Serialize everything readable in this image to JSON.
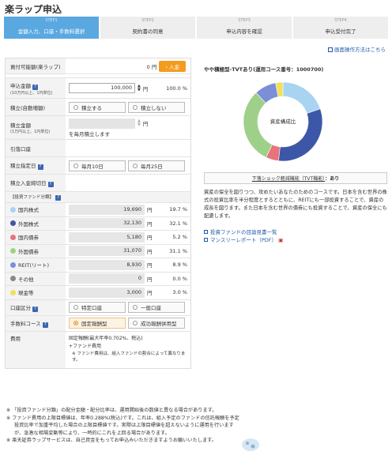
{
  "page_title": "楽ラップ申込",
  "steps": [
    {
      "num": "STEP1",
      "label": "金額入力、口座・手数料選択",
      "active": true
    },
    {
      "num": "STEP2",
      "label": "契約書の同意",
      "active": false
    },
    {
      "num": "STEP3",
      "label": "申込内容を確認",
      "active": false
    },
    {
      "num": "STEP4",
      "label": "申込受付完了",
      "active": false
    }
  ],
  "help_link": "画面操作方法はこちら",
  "form": {
    "available_label": "買付可能額(楽ラップ)",
    "available_value": "0 円",
    "deposit_button": "› 入金",
    "amount_label": "申込金額",
    "amount_sub": "(10万円以上、1円単位)",
    "amount_value": "100,000",
    "amount_unit": "円",
    "amount_pct": "100.0 %",
    "auto_label": "積立(自動増額)",
    "auto_yes": "積立する",
    "auto_no": "積立しない",
    "tsumitate_label": "積立金額",
    "tsumitate_sub": "(1万円以上、1円単位)",
    "tsumitate_unit": "円",
    "tsumitate_note": "を毎月積立します",
    "withdraw_label": "引落口座",
    "date_label": "積立指定日",
    "date_10": "毎月10日",
    "date_25": "毎月25日",
    "entry_label": "積立入金締切日",
    "fund_header": "【投資ファンド分類】",
    "unit": "円",
    "funds": [
      {
        "name": "国内株式",
        "value": "19,690",
        "pct": "19.7 %",
        "color": "#a8d4f2"
      },
      {
        "name": "外国株式",
        "value": "32,130",
        "pct": "32.1 %",
        "color": "#3d57a8"
      },
      {
        "name": "国内債券",
        "value": "5,180",
        "pct": "5.2 %",
        "color": "#e8737a"
      },
      {
        "name": "外国債券",
        "value": "31,070",
        "pct": "31.1 %",
        "color": "#9fd08a"
      },
      {
        "name": "REIT(リート)",
        "value": "8,930",
        "pct": "8.9 %",
        "color": "#7a8fd6"
      },
      {
        "name": "その他",
        "value": "0",
        "pct": "0.0 %",
        "color": "#888888"
      },
      {
        "name": "現金等",
        "value": "3,000",
        "pct": "3.0 %",
        "color": "#f2df5c"
      }
    ],
    "account_label": "口座区分",
    "account_tokutei": "特定口座",
    "account_ippan": "一般口座",
    "fee_label": "手数料コース",
    "fee_fixed": "固定報酬型",
    "fee_success": "成功報酬併用型",
    "cost_label": "費用",
    "cost_line1": "固定報酬(最大年率0.702%、税込)",
    "cost_line2": "+ファンド費用",
    "cost_line3": "※ ファンド費用は、組入ファンドの割合によって異なります。"
  },
  "right": {
    "course_title": "やや積極型-TVTあり(運用コース番号：1000700)",
    "donut_label": "資産構成比",
    "shock_text": "下落ショック軽減機能（TVT機能）",
    "shock_value": "：あり",
    "description": "資産の保全を図りつつ、攻めたいあなたのためのコースです。日本を含む世界の株式の投資比率を半分程度とするとともに、REITにも一部投資することで、資産の成長を図ります。また日本を含む世界の債券にも投資することで、資産の保全にも配慮します。",
    "link1": "投資ファンドの目論見書一覧",
    "link2": "マンスリーレポート（PDF）"
  },
  "notes": [
    "※ 「投資ファンド分類」の配分金額・配分比率は、運用開始後の数値と異なる場合があります。",
    "※ ファンド費用の上限目標値は、年率0.288%(税込)です。これは、組入予定のファンドの信託報酬を予定投資比率で加重平均した場合の上限目標値です。実際は上限目標値を超えないように運用を行いますが、急激な相場変動等により、一時的にこれを上回る場合があります。",
    "※ 楽天証券ラップサービスは、自己資金をもってお申込みいただきますようお願いいたします。"
  ],
  "chart_data": {
    "type": "pie",
    "title": "資産構成比",
    "categories": [
      "国内株式",
      "外国株式",
      "国内債券",
      "外国債券",
      "REIT(リート)",
      "その他",
      "現金等"
    ],
    "values": [
      19.7,
      32.1,
      5.2,
      31.1,
      8.9,
      0.0,
      3.0
    ]
  }
}
